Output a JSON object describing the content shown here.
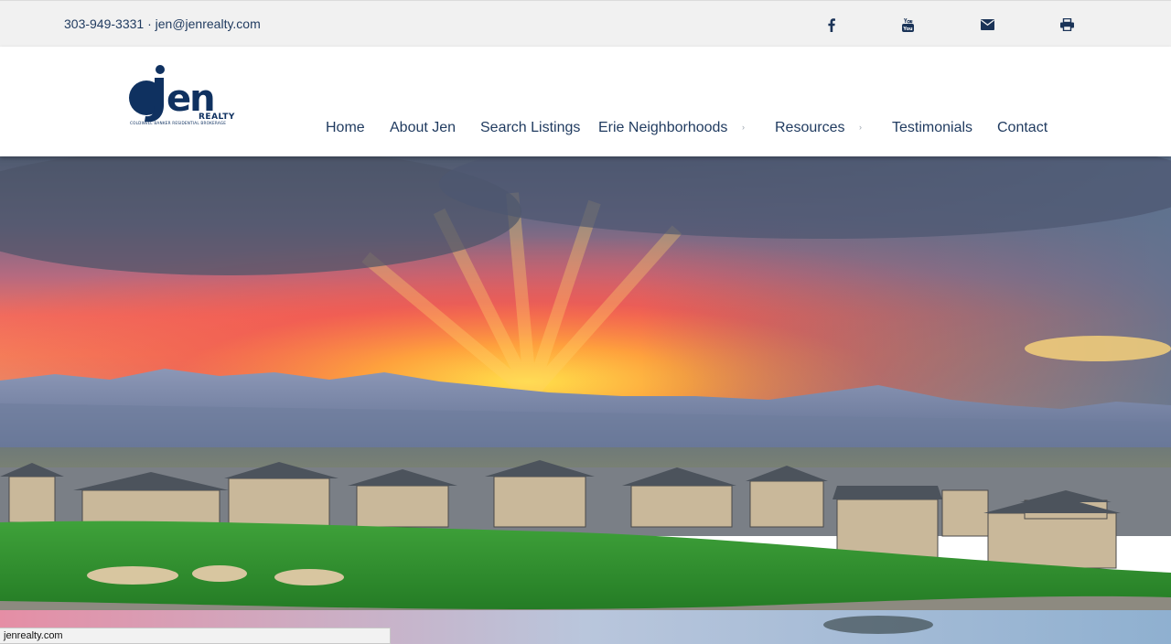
{
  "topbar": {
    "phone": "303-949-3331",
    "separator": "·",
    "email": "jen@jenrealty.com",
    "social": [
      "facebook-icon",
      "youtube-icon",
      "envelope-icon",
      "print-icon"
    ]
  },
  "logo": {
    "name": "jen",
    "sub": "REALTY",
    "tagline": "COLDWELL BANKER RESIDENTIAL BROKERAGE",
    "color": "#0f3160"
  },
  "nav": {
    "items": [
      {
        "label": "Home"
      },
      {
        "label": "About Jen"
      },
      {
        "label": "Search Listings"
      },
      {
        "label": "Erie Neighborhoods"
      },
      {
        "label": "Resources"
      },
      {
        "label": "Testimonials"
      },
      {
        "label": "Contact"
      }
    ],
    "submenu_marker": "›"
  },
  "statusbar": {
    "url": "jenrealty.com"
  },
  "colors": {
    "topbar_bg": "#f1f1f1",
    "text_navy": "#1f3a5f"
  }
}
